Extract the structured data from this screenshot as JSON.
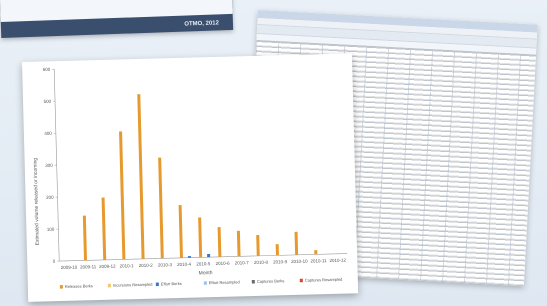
{
  "background_card": {
    "caption": "OTMO, 2012"
  },
  "chart_data": {
    "type": "bar",
    "title": "",
    "xlabel": "Month",
    "ylabel": "Estimated volume released or incoming",
    "ylim": [
      0,
      600
    ],
    "yticks": [
      0,
      100,
      200,
      300,
      400,
      500,
      600
    ],
    "categories": [
      "2009-10",
      "2009-11",
      "2009-12",
      "2010-1",
      "2010-2",
      "2010-3",
      "2010-4",
      "2010-5",
      "2010-6",
      "2010-7",
      "2010-8",
      "2010-9",
      "2010-10",
      "2010-11",
      "2010-12"
    ],
    "series": [
      {
        "name": "Releases Berks",
        "color": "#e69a2e",
        "values": [
          0,
          140,
          195,
          400,
          515,
          315,
          165,
          125,
          93,
          80,
          65,
          35,
          72,
          13,
          0
        ]
      },
      {
        "name": "Incursions Resampled",
        "color": "#f0c66a",
        "values": [
          0,
          0,
          0,
          0,
          0,
          0,
          0,
          0,
          0,
          0,
          0,
          0,
          0,
          0,
          0
        ]
      },
      {
        "name": "Effort Berks",
        "color": "#3c78c0",
        "values": [
          0,
          0,
          0,
          0,
          0,
          0,
          5,
          10,
          0,
          0,
          0,
          0,
          0,
          0,
          0
        ]
      },
      {
        "name": "Effort Resampled",
        "color": "#9ec3e6",
        "values": [
          0,
          0,
          0,
          0,
          0,
          0,
          0,
          0,
          0,
          0,
          0,
          0,
          0,
          0,
          0
        ]
      },
      {
        "name": "Captures Berks",
        "color": "#6a6a6a",
        "values": [
          0,
          0,
          0,
          0,
          0,
          0,
          0,
          0,
          0,
          0,
          0,
          0,
          0,
          0,
          0
        ]
      },
      {
        "name": "Captures Resampled",
        "color": "#d9442a",
        "values": [
          0,
          0,
          0,
          0,
          0,
          0,
          0,
          0,
          0,
          0,
          0,
          0,
          0,
          0,
          0
        ]
      }
    ],
    "legend_position": "bottom",
    "grid": false
  }
}
